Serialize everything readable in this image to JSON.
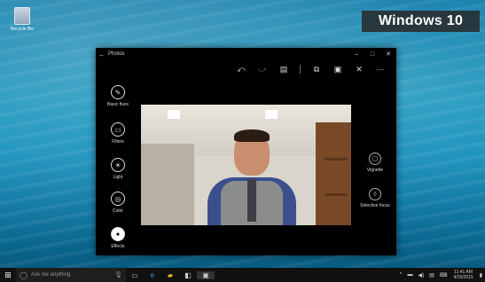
{
  "desktop": {
    "recycle_bin_label": "Recycle Bin",
    "watermark": "Windows 10"
  },
  "window": {
    "title": "Photos",
    "toolbar_icons": [
      "undo-icon",
      "redo-icon",
      "compare-icon",
      "save-copy-icon",
      "save-icon",
      "cancel-icon",
      "more-icon"
    ],
    "tools_left": [
      {
        "label": "Basic fixes",
        "icon": "pen-icon"
      },
      {
        "label": "Filters",
        "icon": "filters-icon"
      },
      {
        "label": "Light",
        "icon": "light-icon"
      },
      {
        "label": "Color",
        "icon": "color-icon"
      },
      {
        "label": "Effects",
        "icon": "effects-icon"
      }
    ],
    "tools_right": [
      {
        "label": "Vignette",
        "icon": "vignette-icon"
      },
      {
        "label": "Selective focus",
        "icon": "focus-icon"
      }
    ]
  },
  "taskbar": {
    "search_placeholder": "Ask me anything",
    "clock_time": "11:41 AM",
    "clock_date": "4/15/2015"
  }
}
